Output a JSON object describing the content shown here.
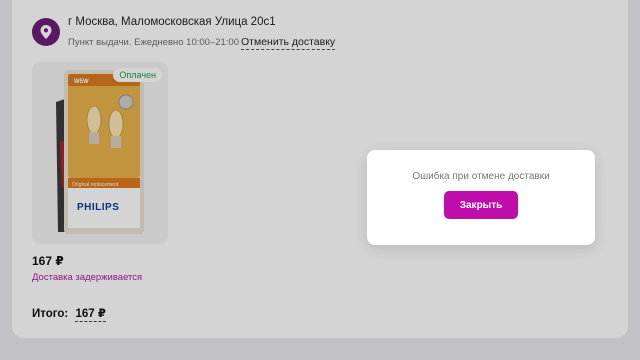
{
  "delivery": {
    "address": "г Москва, Маломосковская Улица 20с1",
    "pickup_info": "Пункт выдачи. Ежедневно 10:00–21:00",
    "cancel_link": "Отменить доставку"
  },
  "product": {
    "status_badge": "Оплачен",
    "price": "167 ₽",
    "delivery_status": "Доставка задерживается",
    "package_brand": "PHILIPS",
    "package_code": "W5W",
    "package_subtitle": "Original replacement"
  },
  "summary": {
    "total_label": "Итого:",
    "total_value": "167 ₽"
  },
  "modal": {
    "message": "Ошибка при отмене доставки",
    "close_label": "Закрыть"
  },
  "colors": {
    "accent": "#c10cac",
    "pin": "#6b1f77",
    "delay": "#b0179f",
    "paid": "#16a34a"
  }
}
